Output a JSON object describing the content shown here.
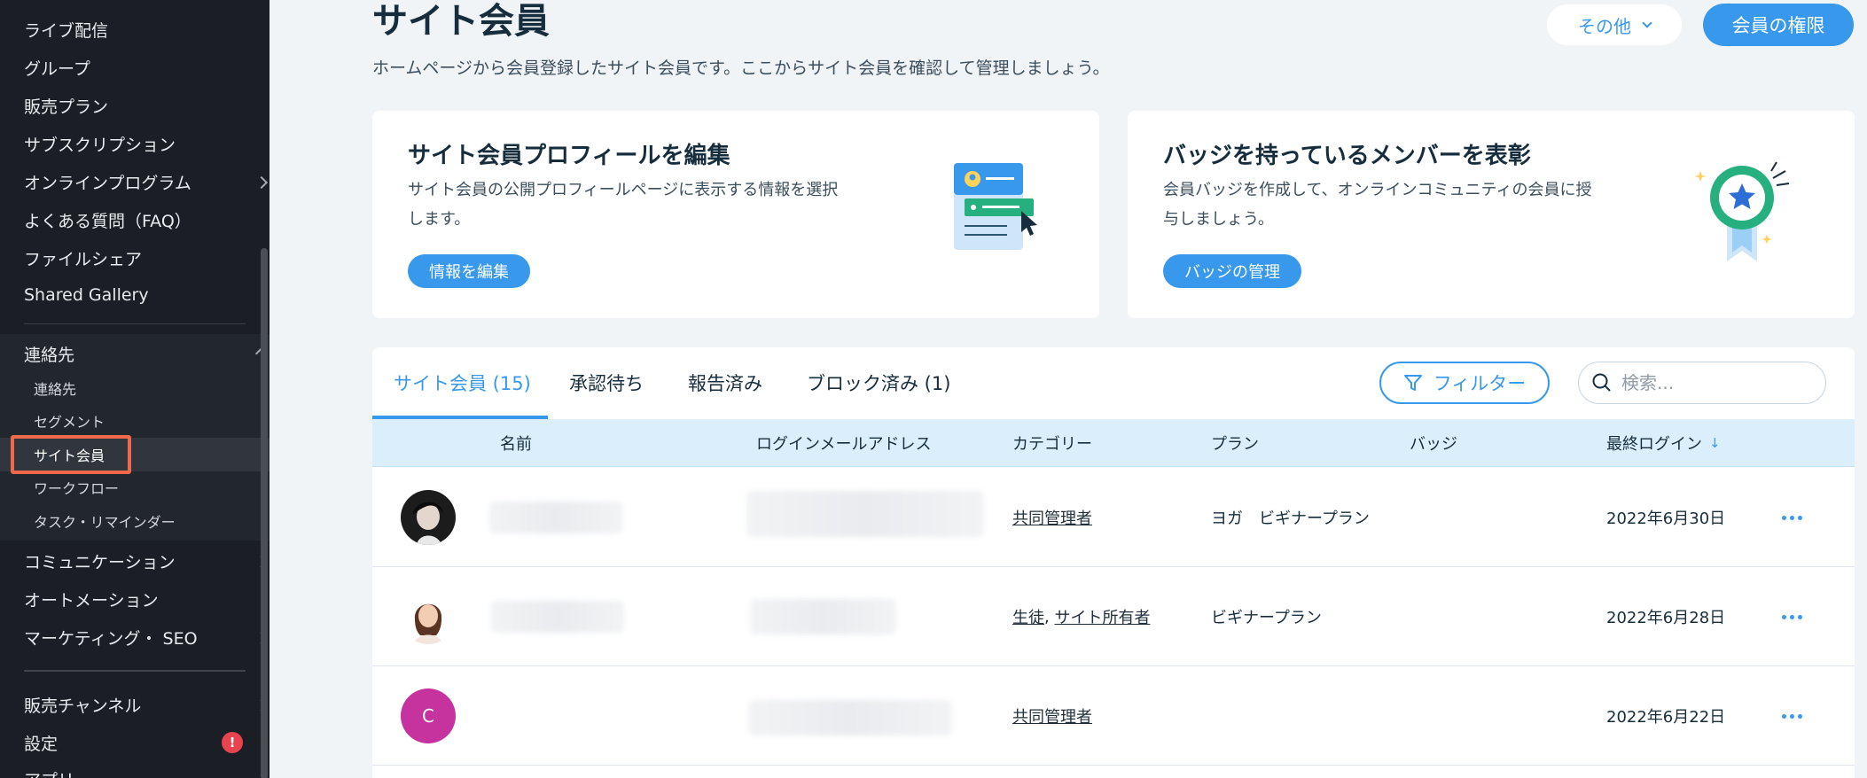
{
  "sidebar": {
    "items_top": [
      {
        "label": "ライブ配信",
        "chevron": false
      },
      {
        "label": "グループ",
        "chevron": false
      },
      {
        "label": "販売プラン",
        "chevron": false
      },
      {
        "label": "サブスクリプション",
        "chevron": false
      },
      {
        "label": "オンラインプログラム",
        "chevron": true
      },
      {
        "label": "よくある質問（FAQ）",
        "chevron": false
      },
      {
        "label": "ファイルシェア",
        "chevron": false
      },
      {
        "label": "Shared Gallery",
        "chevron": false
      }
    ],
    "group": {
      "label": "連絡先",
      "sub_items": [
        "連絡先",
        "セグメント",
        "サイト会員",
        "ワークフロー",
        "タスク・リマインダー"
      ],
      "active": "サイト会員"
    },
    "items_bottom": [
      {
        "label": "コミュニケーション",
        "chevron": true
      },
      {
        "label": "オートメーション",
        "chevron": false
      },
      {
        "label": "マーケティング・ SEO",
        "chevron": true
      },
      {
        "label": "販売チャンネル",
        "chevron": true
      },
      {
        "label": "設定",
        "chevron": false,
        "badge": "!"
      },
      {
        "label": "アプリ",
        "chevron": true
      }
    ]
  },
  "header": {
    "title": "サイト会員",
    "subtitle": "ホームページから会員登録したサイト会員です。ここからサイト会員を確認して管理しましょう。",
    "more_button": "その他",
    "permissions_button": "会員の権限"
  },
  "cards": [
    {
      "title": "サイト会員プロフィールを編集",
      "description": "サイト会員の公開プロフィールページに表示する情報を選択します。",
      "button": "情報を編集",
      "icon": "profile-card-illustration"
    },
    {
      "title": "バッジを持っているメンバーを表彰",
      "description": "会員バッジを作成して、オンラインコミュニティの会員に授与しましょう。",
      "button": "バッジの管理",
      "icon": "badge-ribbon-illustration"
    }
  ],
  "tabs": [
    {
      "label": "サイト会員 (15)",
      "active": true
    },
    {
      "label": "承認待ち",
      "active": false
    },
    {
      "label": "報告済み",
      "active": false
    },
    {
      "label": "ブロック済み (1)",
      "active": false
    }
  ],
  "filter_button": "フィルター",
  "search": {
    "placeholder": "検索..."
  },
  "table": {
    "columns": [
      "名前",
      "ログインメールアドレス",
      "カテゴリー",
      "プラン",
      "バッジ",
      "最終ログイン"
    ],
    "sort_column": "最終ログイン",
    "rows": [
      {
        "avatar": "photo-dark",
        "categories": [
          "共同管理者"
        ],
        "plan": "ヨガ　ビギナープラン",
        "last_login": "2022年6月30日"
      },
      {
        "avatar": "photo-light",
        "categories": [
          "生徒",
          "サイト所有者"
        ],
        "plan": "ビギナープラン",
        "last_login": "2022年6月28日"
      },
      {
        "avatar": "letter",
        "avatar_letter": "C",
        "categories": [
          "共同管理者"
        ],
        "plan": "",
        "last_login": "2022年6月22日"
      }
    ]
  },
  "colors": {
    "accent": "#3899ec",
    "sidebar_bg": "#1b1e24",
    "highlight": "#ef6a4b",
    "avatar_letter_bg": "#c6339e"
  }
}
